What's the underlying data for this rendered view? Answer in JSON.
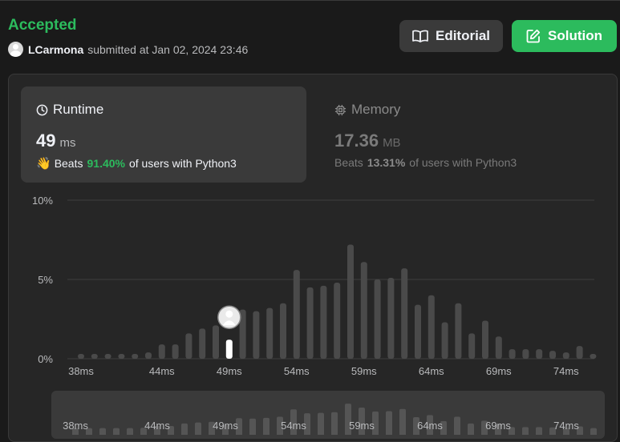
{
  "submission": {
    "status": "Accepted",
    "username": "LCarmona",
    "submitted_text": "submitted at Jan 02, 2024 23:46"
  },
  "buttons": {
    "editorial": "Editorial",
    "solution": "Solution"
  },
  "runtime": {
    "title": "Runtime",
    "value": "49",
    "unit": "ms",
    "beats_prefix": "Beats",
    "beats_pct": "91.40%",
    "beats_suffix": "of users with Python3"
  },
  "memory": {
    "title": "Memory",
    "value": "17.36",
    "unit": "MB",
    "beats_prefix": "Beats",
    "beats_pct": "13.31%",
    "beats_suffix": "of users with Python3"
  },
  "colors": {
    "accent_green": "#2cbb5d",
    "bar": "#4a4a4a",
    "bar_selected": "#ffffff"
  },
  "icons": {
    "editorial": "book-open-icon",
    "solution": "edit-icon",
    "runtime": "clock-icon",
    "memory": "chip-icon",
    "beats": "waving-hand-icon"
  },
  "chart_data": {
    "type": "bar",
    "ylim": [
      0,
      10
    ],
    "yticks": [
      "0%",
      "5%",
      "10%"
    ],
    "xtick_labels": [
      "38ms",
      "44ms",
      "49ms",
      "54ms",
      "59ms",
      "64ms",
      "69ms",
      "74ms"
    ],
    "x": [
      38,
      39,
      40,
      41,
      42,
      43,
      44,
      45,
      46,
      47,
      48,
      49,
      50,
      51,
      52,
      53,
      54,
      55,
      56,
      57,
      58,
      59,
      60,
      61,
      62,
      63,
      64,
      65,
      66,
      67,
      68,
      69,
      70,
      71,
      72,
      73,
      74,
      75,
      76
    ],
    "values": [
      0.3,
      0.3,
      0.3,
      0.3,
      0.3,
      0.4,
      0.9,
      0.9,
      1.6,
      1.9,
      2.1,
      1.2,
      3.1,
      3.0,
      3.2,
      3.5,
      5.6,
      4.5,
      4.6,
      4.8,
      7.2,
      6.1,
      5.0,
      5.1,
      5.7,
      3.4,
      4.0,
      2.3,
      3.5,
      1.6,
      2.4,
      1.4,
      0.6,
      0.6,
      0.6,
      0.5,
      0.4,
      0.8,
      0.3
    ],
    "selected_x": 49,
    "grid": true,
    "navigator_xtick_labels": [
      "38ms",
      "44ms",
      "49ms",
      "54ms",
      "59ms",
      "64ms",
      "69ms",
      "74ms"
    ]
  }
}
